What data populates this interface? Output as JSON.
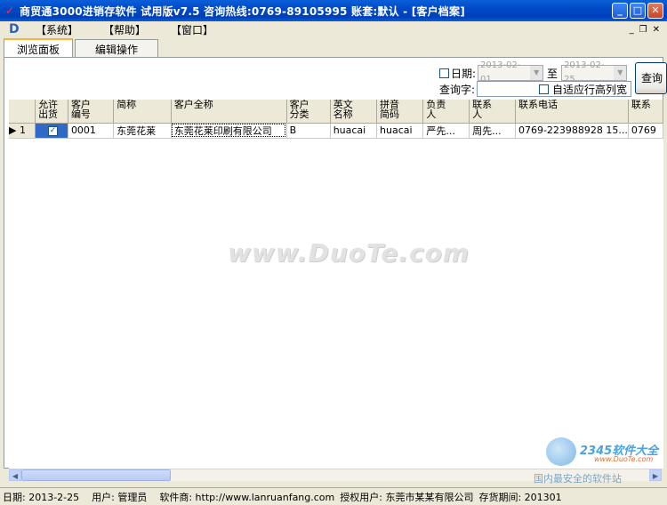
{
  "window": {
    "title": "商贸通3000进销存软件 试用版v7.5 咨询热线:0769-89105995 账套:默认 - [客户档案]",
    "minimize": "_",
    "maximize": "□",
    "close": "✕"
  },
  "menu": {
    "items": [
      "【系统】",
      "【帮助】",
      "【窗口】"
    ],
    "mdi_min": "_",
    "mdi_restore": "❐",
    "mdi_close": "✕"
  },
  "tabs": [
    {
      "label": "浏览面板",
      "active": true
    },
    {
      "label": "编辑操作",
      "active": false
    }
  ],
  "filter": {
    "date_label": "日期:",
    "date_from": "2013-02-01",
    "to_label": "至",
    "date_to": "2013-02-25",
    "query_label": "查询字:",
    "query_value": "",
    "autofit_label": "自适应行高列宽",
    "query_button": "查询"
  },
  "grid": {
    "columns": [
      {
        "l1": "允许",
        "l2": "出货"
      },
      {
        "l1": "客户",
        "l2": "编号"
      },
      {
        "l1": "简称",
        "l2": ""
      },
      {
        "l1": "客户全称",
        "l2": ""
      },
      {
        "l1": "客户",
        "l2": "分类"
      },
      {
        "l1": "英文",
        "l2": "名称"
      },
      {
        "l1": "拼音",
        "l2": "简码"
      },
      {
        "l1": "负责",
        "l2": "人"
      },
      {
        "l1": "联系",
        "l2": "人"
      },
      {
        "l1": "联系电话",
        "l2": ""
      },
      {
        "l1": "联系",
        "l2": ""
      }
    ],
    "rows": [
      {
        "row_no": "1",
        "allow_ship": true,
        "code": "0001",
        "short_name": "东莞花莱",
        "full_name": "东莞花莱印刷有限公司",
        "category": "B",
        "english_name": "huacai",
        "pinyin": "huacai",
        "owner": "严先...",
        "contact": "周先...",
        "phone": "0769-223988928 15...",
        "extra": "0769"
      }
    ]
  },
  "watermark": "www.DuoTe.com",
  "site_logo": {
    "brand": "2345软件大全",
    "url": "www.DuoTe.com",
    "slogan": "国内最安全的软件站"
  },
  "statusbar": {
    "date": "日期: 2013-2-25",
    "user": "用户: 管理员",
    "vendor": "软件商: http://www.lanruanfang.com",
    "licensee": "授权用户: 东莞市某某有限公司",
    "period": "存货期间: 201301"
  }
}
